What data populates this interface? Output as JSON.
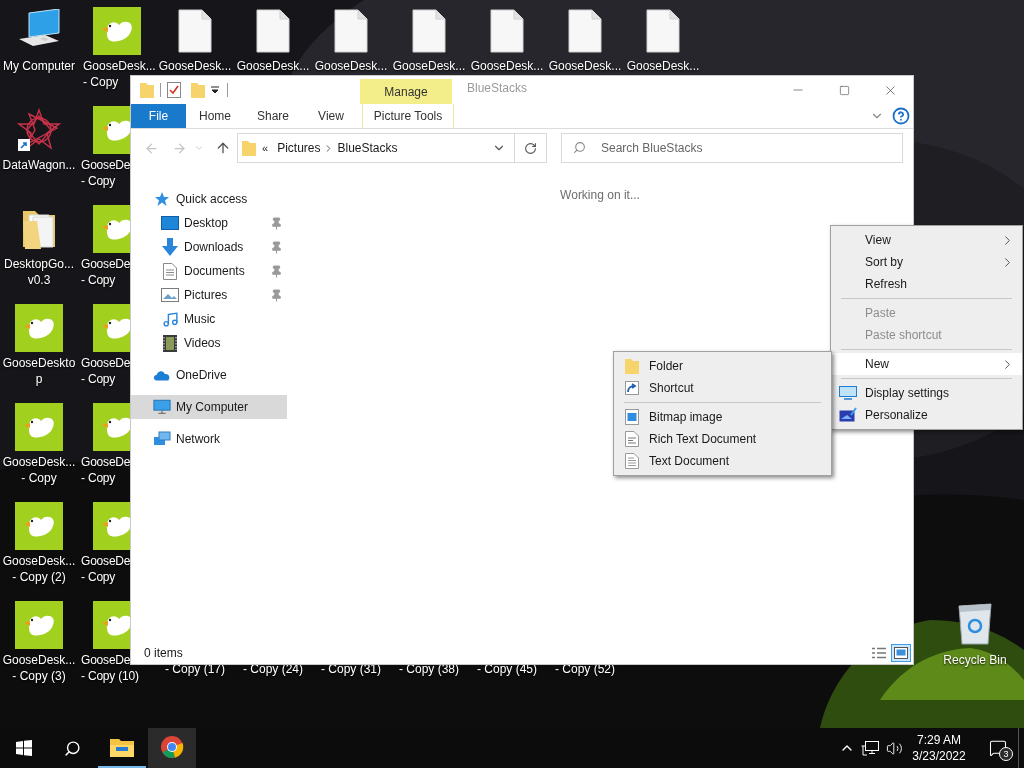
{
  "desktop": {
    "columns": [
      [
        {
          "kind": "computer",
          "label_lines": [
            "My Computer"
          ]
        },
        {
          "kind": "datawagon",
          "label_lines": [
            "DataWagon..."
          ]
        },
        {
          "kind": "folder",
          "label_lines": [
            "DesktopGo...",
            "v0.3"
          ]
        },
        {
          "kind": "goose",
          "label_lines": [
            "GooseDeskto",
            "p"
          ]
        },
        {
          "kind": "goose",
          "label_lines": [
            "GooseDesk...",
            "- Copy"
          ]
        },
        {
          "kind": "goose",
          "label_lines": [
            "GooseDesk...",
            "- Copy (2)"
          ]
        },
        {
          "kind": "goose",
          "label_lines": [
            "GooseDesk...",
            "- Copy (3)"
          ]
        }
      ],
      [
        {
          "kind": "goose",
          "label_lines": [
            "GooseDesk...",
            "- Copy"
          ]
        },
        {
          "kind": "goose",
          "label_lines": [
            "GooseDe",
            "- Copy"
          ]
        },
        {
          "kind": "goose",
          "label_lines": [
            "GooseDe",
            "- Copy"
          ]
        },
        {
          "kind": "goose",
          "label_lines": [
            "GooseDe",
            "- Copy"
          ]
        },
        {
          "kind": "goose",
          "label_lines": [
            "GooseDe",
            "- Copy"
          ]
        },
        {
          "kind": "goose",
          "label_lines": [
            "GooseDe",
            "- Copy"
          ]
        },
        {
          "kind": "goose",
          "label_lines": [
            "GooseDe",
            "- Copy (10)"
          ]
        }
      ],
      [
        {
          "kind": "document",
          "label_lines": [
            "GooseDesk..."
          ]
        },
        {
          "kind": "label_only",
          "label_lines": [
            "- Copy (17)"
          ]
        }
      ],
      [
        {
          "kind": "document",
          "label_lines": [
            "GooseDesk..."
          ]
        },
        {
          "kind": "label_only",
          "label_lines": [
            "- Copy (24)"
          ]
        }
      ],
      [
        {
          "kind": "document",
          "label_lines": [
            "GooseDesk..."
          ]
        },
        {
          "kind": "label_only",
          "label_lines": [
            "- Copy (31)"
          ]
        }
      ],
      [
        {
          "kind": "document",
          "label_lines": [
            "GooseDesk..."
          ]
        },
        {
          "kind": "label_only",
          "label_lines": [
            "- Copy (38)"
          ]
        }
      ],
      [
        {
          "kind": "document",
          "label_lines": [
            "GooseDesk..."
          ]
        },
        {
          "kind": "label_only",
          "label_lines": [
            "- Copy (45)"
          ]
        }
      ],
      [
        {
          "kind": "document",
          "label_lines": [
            "GooseDesk..."
          ]
        },
        {
          "kind": "label_only",
          "label_lines": [
            "- Copy (52)"
          ]
        }
      ],
      [
        {
          "kind": "document",
          "label_lines": [
            "GooseDesk..."
          ]
        }
      ]
    ],
    "recycle_bin": {
      "label": "Recycle Bin"
    }
  },
  "explorer": {
    "contextual_group": "Manage",
    "title": "BlueStacks",
    "ribbon_tabs": [
      {
        "label": "File",
        "kind": "file",
        "selected": false
      },
      {
        "label": "Home",
        "kind": "tab",
        "selected": false
      },
      {
        "label": "Share",
        "kind": "tab",
        "selected": false
      },
      {
        "label": "View",
        "kind": "tab",
        "selected": false
      },
      {
        "label": "Picture Tools",
        "kind": "contextual",
        "selected": false
      }
    ],
    "address": {
      "overflow": "«",
      "segments": [
        "Pictures",
        "BlueStacks"
      ]
    },
    "search": {
      "placeholder": "Search BlueStacks"
    },
    "nav": [
      {
        "label": "Quick access",
        "kind": "star",
        "selected": false,
        "children": [
          {
            "label": "Desktop",
            "kind": "desktop",
            "pinned": true,
            "selected": false
          },
          {
            "label": "Downloads",
            "kind": "download",
            "pinned": true,
            "selected": false
          },
          {
            "label": "Documents",
            "kind": "documents",
            "pinned": true,
            "selected": false
          },
          {
            "label": "Pictures",
            "kind": "pictures",
            "pinned": true,
            "selected": false
          },
          {
            "label": "Music",
            "kind": "music",
            "pinned": false,
            "selected": false
          },
          {
            "label": "Videos",
            "kind": "videos",
            "pinned": false,
            "selected": false
          }
        ]
      },
      {
        "label": "OneDrive",
        "kind": "cloud",
        "selected": false
      },
      {
        "label": "My Computer",
        "kind": "computer",
        "selected": true
      },
      {
        "label": "Network",
        "kind": "network",
        "selected": false
      }
    ],
    "status_message": "Working on it...",
    "item_count": "0 items",
    "view_buttons": [
      {
        "kind": "details",
        "selected": false
      },
      {
        "kind": "large_icons",
        "selected": true
      }
    ]
  },
  "context_menu": {
    "items": [
      {
        "kind": "item",
        "label": "View",
        "submenu": true,
        "disabled": false,
        "selected": false
      },
      {
        "kind": "item",
        "label": "Sort by",
        "submenu": true,
        "disabled": false,
        "selected": false
      },
      {
        "kind": "item",
        "label": "Refresh",
        "submenu": false,
        "disabled": false,
        "selected": false
      },
      {
        "kind": "separator"
      },
      {
        "kind": "item",
        "label": "Paste",
        "submenu": false,
        "disabled": true,
        "selected": false
      },
      {
        "kind": "item",
        "label": "Paste shortcut",
        "submenu": false,
        "disabled": true,
        "selected": false
      },
      {
        "kind": "separator"
      },
      {
        "kind": "item",
        "label": "New",
        "submenu": true,
        "disabled": false,
        "selected": true
      },
      {
        "kind": "separator"
      },
      {
        "kind": "display",
        "label": "Display settings",
        "submenu": false,
        "disabled": false,
        "selected": false
      },
      {
        "kind": "personalize",
        "label": "Personalize",
        "submenu": false,
        "disabled": false,
        "selected": false
      }
    ]
  },
  "new_submenu": {
    "items": [
      {
        "kind": "folder",
        "label": "Folder"
      },
      {
        "kind": "shortcut",
        "label": "Shortcut"
      },
      {
        "kind": "separator"
      },
      {
        "kind": "bitmap",
        "label": "Bitmap image"
      },
      {
        "kind": "richtext",
        "label": "Rich Text Document"
      },
      {
        "kind": "text",
        "label": "Text Document"
      }
    ]
  },
  "taskbar": {
    "apps": [
      {
        "kind": "explorer",
        "running": true,
        "selected": false
      },
      {
        "kind": "chrome",
        "running": false,
        "selected": true
      }
    ],
    "clock": {
      "time": "7:29 AM",
      "date": "3/23/2022"
    },
    "notifications": {
      "count": "3"
    }
  }
}
